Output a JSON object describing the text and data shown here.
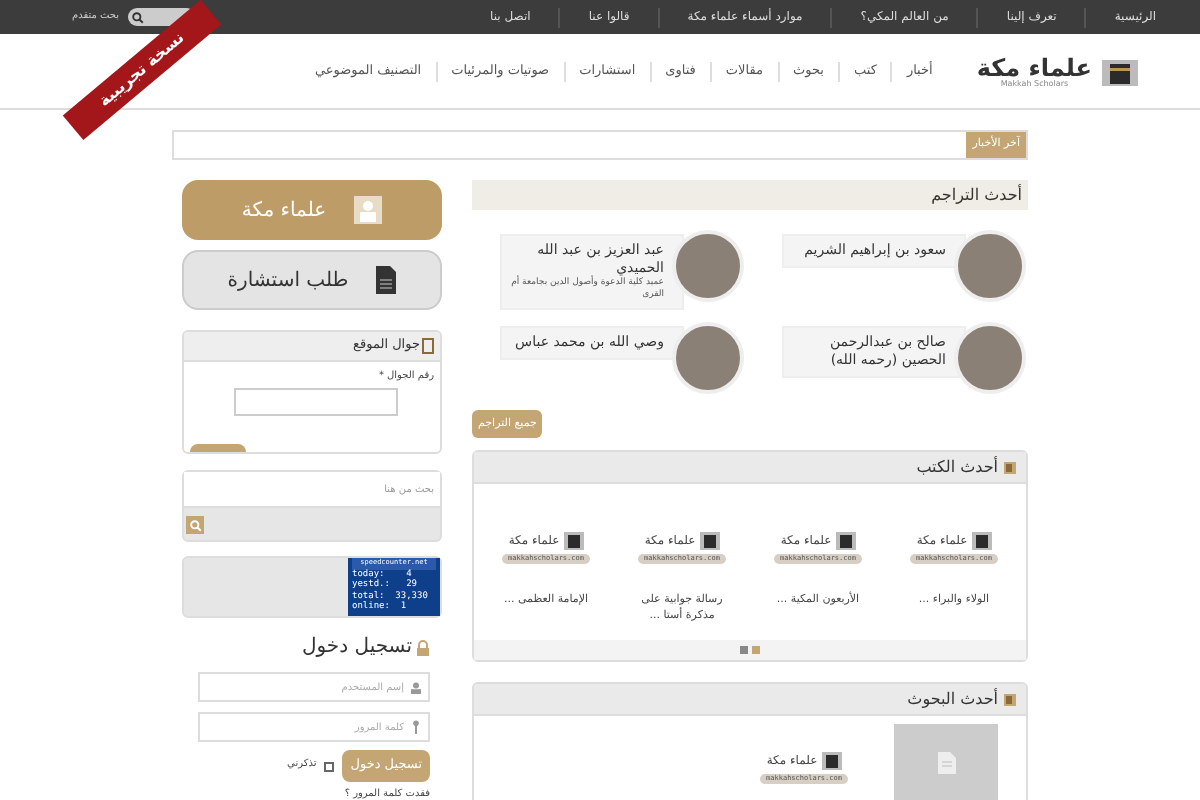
{
  "top_nav": [
    "الرئيسية",
    "تعرف إلينا",
    "من العالم المكي؟",
    "موارد أسماء علماء مكة",
    "قالوا عنا",
    "اتصل بنا"
  ],
  "top_search": {
    "link": "بحث متقدم"
  },
  "logo": {
    "title": "علماء مكة",
    "subtitle": "Makkah Scholars"
  },
  "main_nav": [
    "أخبار",
    "كتب",
    "بحوث",
    "مقالات",
    "فتاوى",
    "استشارات",
    "صوتيات والمرئيات",
    "التصنيف الموضوعي"
  ],
  "ribbon": "نسخة تجريبية",
  "news_bar": {
    "label": "آخر الأخبار"
  },
  "sidebar": {
    "buttons": [
      {
        "label": "علماء مكة",
        "kind": "scholars"
      },
      {
        "label": "طلب استشارة",
        "kind": "request"
      }
    ],
    "mobile": {
      "title": "جوال الموقع",
      "field_label": "رقم الجوال *"
    },
    "search": {
      "placeholder": "بحث من هنا"
    },
    "counter": {
      "site": "speedcounter.net",
      "lines": [
        "today:    4",
        "yestd.:   29",
        "total:  33,330",
        "online:  1"
      ]
    },
    "login": {
      "title": "تسجيل دخول",
      "username_placeholder": "إسم المستخدم",
      "password_placeholder": "كلمة المرور",
      "button": "تسجيل دخول",
      "remember": "تذكرني",
      "remember_checked": false,
      "lost": "فقدت كلمة المرور ؟"
    }
  },
  "biographies": {
    "title": "أحدث التراجم",
    "button": "جميع التراجم",
    "items": [
      {
        "name": "سعود بن إبراهيم الشريم"
      },
      {
        "name": "عبد العزيز بن عبد الله الحميدي",
        "subtitle": "عميد كلية الدعوة وأصول الدين بجامعة أم القرى"
      },
      {
        "name": "صالح بن عبدالرحمن الحصين (رحمه الله)"
      },
      {
        "name": "وصي الله بن محمد عباس"
      }
    ]
  },
  "books": {
    "title": "أحدث الكتب",
    "pages": [
      {
        "selected": true
      },
      {
        "selected": false
      }
    ],
    "items": [
      {
        "cover_title": "علماء مكة",
        "cover_url": "makkahscholars.com",
        "title": "الولاء والبراء ..."
      },
      {
        "cover_title": "علماء مكة",
        "cover_url": "makkahscholars.com",
        "title": "الأربعون المكية ..."
      },
      {
        "cover_title": "علماء مكة",
        "cover_url": "makkahscholars.com",
        "title": "رسالة جوابية على مذكرة أستا ..."
      },
      {
        "cover_title": "علماء مكة",
        "cover_url": "makkahscholars.com",
        "title": "الإمامة العظمى ..."
      }
    ]
  },
  "research": {
    "title": "أحدث البحوث",
    "items": [
      {
        "kind": "document"
      },
      {
        "kind": "logo",
        "cover_title": "علماء مكة",
        "cover_url": "makkahscholars.com"
      }
    ]
  }
}
